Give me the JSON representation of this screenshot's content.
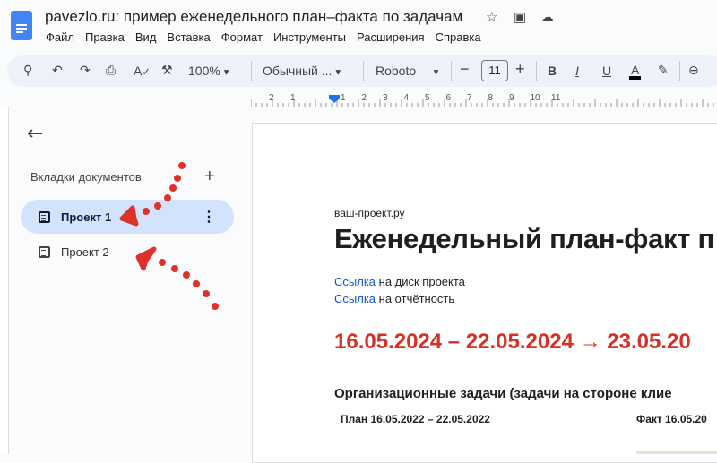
{
  "window": {
    "title": "pavezlo.ru: пример еженедельного план–факта по задачам",
    "icons": [
      "star-icon",
      "move-folder-icon",
      "cloud-saved-icon"
    ]
  },
  "menu": [
    "Файл",
    "Правка",
    "Вид",
    "Вставка",
    "Формат",
    "Инструменты",
    "Расширения",
    "Справка"
  ],
  "toolbar": {
    "zoom": "100%",
    "style": "Обычный ...",
    "font": "Roboto",
    "font_size": "11",
    "bold": "B",
    "italic": "I",
    "underline": "U",
    "text_color": "A",
    "text_color_value": "#000000"
  },
  "ruler": [
    "2",
    "1",
    "1",
    "2",
    "3",
    "4",
    "5",
    "6",
    "7",
    "8",
    "9",
    "10",
    "11"
  ],
  "sidebar": {
    "heading": "Вкладки документов",
    "add": "+",
    "tabs": [
      {
        "label": "Проект 1",
        "selected": true
      },
      {
        "label": "Проект 2",
        "selected": false
      }
    ]
  },
  "document": {
    "site": "ваш-проект.ру",
    "title": "Еженедельный план-факт п",
    "links": [
      {
        "link": "Ссылка",
        "text": " на диск проекта"
      },
      {
        "link": "Ссылка",
        "text": " на отчётность"
      }
    ],
    "dates": "16.05.2024 – 22.05.2024 → 23.05.20",
    "section": "Организационные задачи (задачи на стороне клие",
    "plan": "План 16.05.2022 – 22.05.2022",
    "fact": "Факт 16.05.20"
  },
  "colors": {
    "accent": "#d93025",
    "selected_tab": "#d3e3fd",
    "link": "#1155cc",
    "annotation": "#e0302a"
  }
}
